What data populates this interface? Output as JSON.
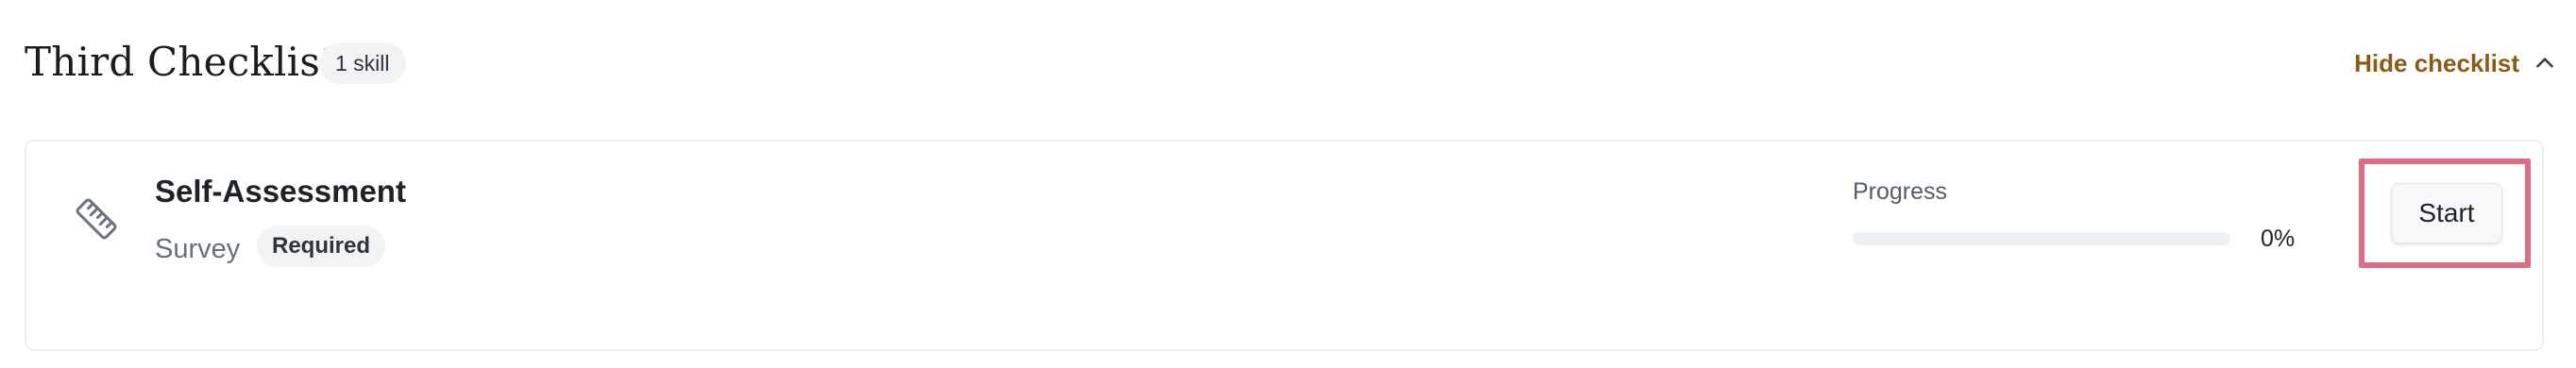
{
  "checklist": {
    "title": "Third Checklist",
    "skill_count": "1 skill",
    "hide_label": "Hide checklist",
    "hide_icon": "chevron-up-icon",
    "accent_color": "#8b5a14"
  },
  "item": {
    "icon": "ruler-icon",
    "name": "Self-Assessment",
    "type": "Survey",
    "badge": "Required",
    "progress_label": "Progress",
    "progress_percent": 0,
    "progress_text": "0%",
    "action_label": "Start",
    "highlight_color": "#e06b87"
  }
}
